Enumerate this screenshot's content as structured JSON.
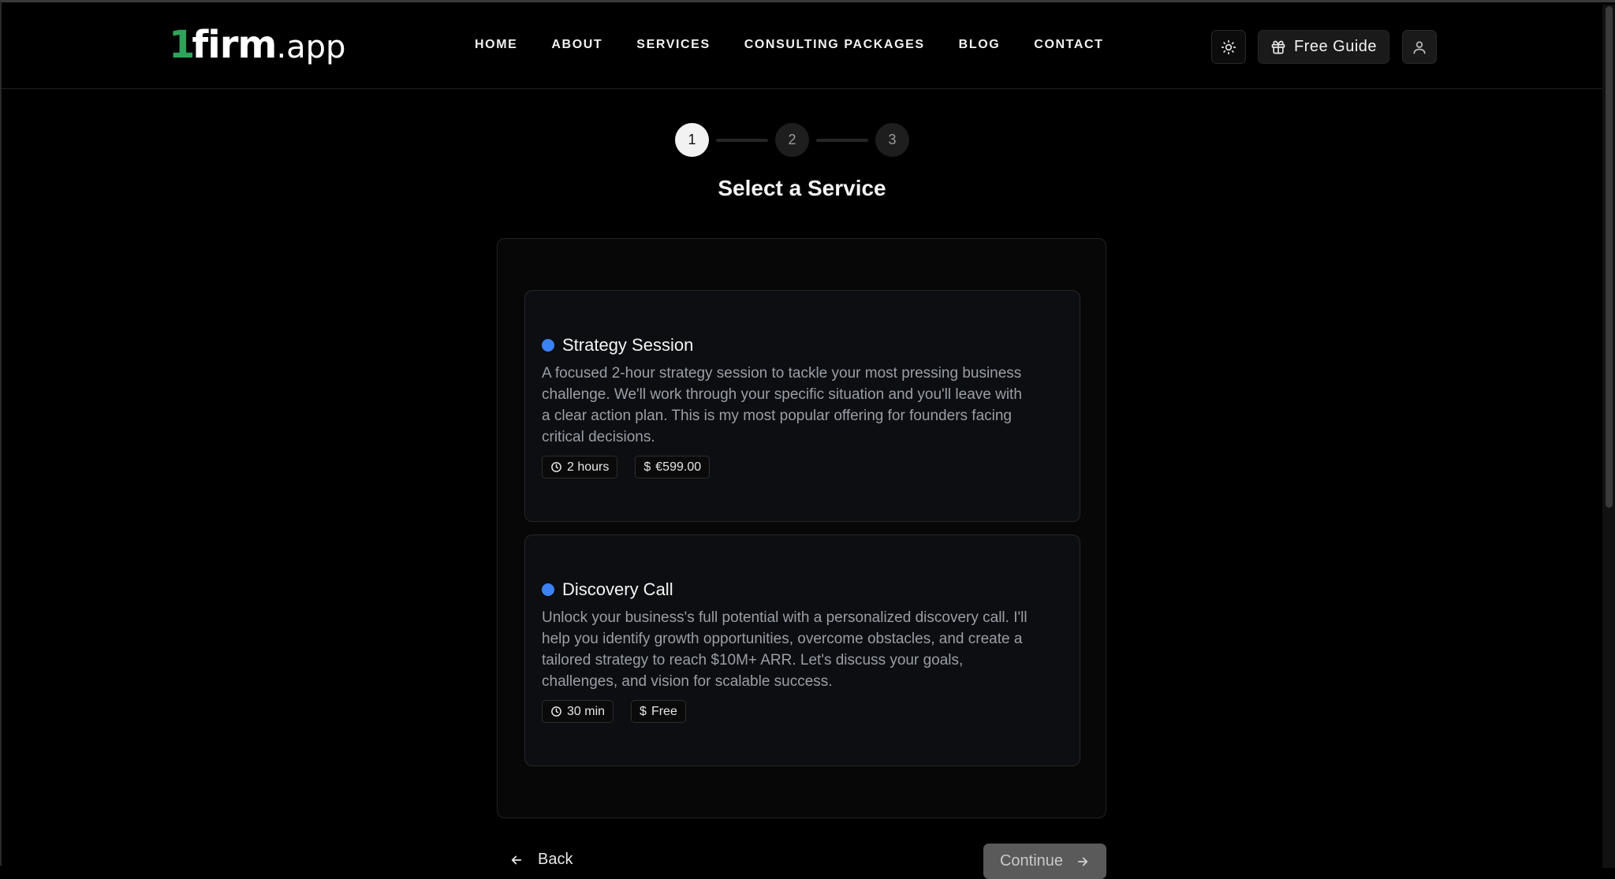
{
  "logo": {
    "one": "1",
    "firm": "firm",
    "app": ".app"
  },
  "nav": {
    "items": [
      "HOME",
      "ABOUT",
      "SERVICES",
      "CONSULTING PACKAGES",
      "BLOG",
      "CONTACT"
    ]
  },
  "header": {
    "guide_label": "Free Guide"
  },
  "stepper": {
    "steps": [
      "1",
      "2",
      "3"
    ],
    "active_step": 1
  },
  "page": {
    "title": "Select a Service"
  },
  "services": [
    {
      "name": "Strategy Session",
      "description": "A focused 2-hour strategy session to tackle your most pressing business challenge. We'll work through your specific situation and you'll leave with a clear action plan. This is my most popular offering for founders facing critical decisions.",
      "duration": "2 hours",
      "price": "€599.00"
    },
    {
      "name": "Discovery Call",
      "description": "Unlock your business's full potential with a personalized discovery call. I'll help you identify growth opportunities, overcome obstacles, and create a tailored strategy to reach $10M+ ARR. Let's discuss your goals, challenges, and vision for scalable success.",
      "duration": "30 min",
      "price": "Free"
    }
  ],
  "footer": {
    "back_label": "Back",
    "continue_label": "Continue"
  },
  "colors": {
    "accent": "#3b82f6",
    "brand_green": "#2fa35a"
  }
}
